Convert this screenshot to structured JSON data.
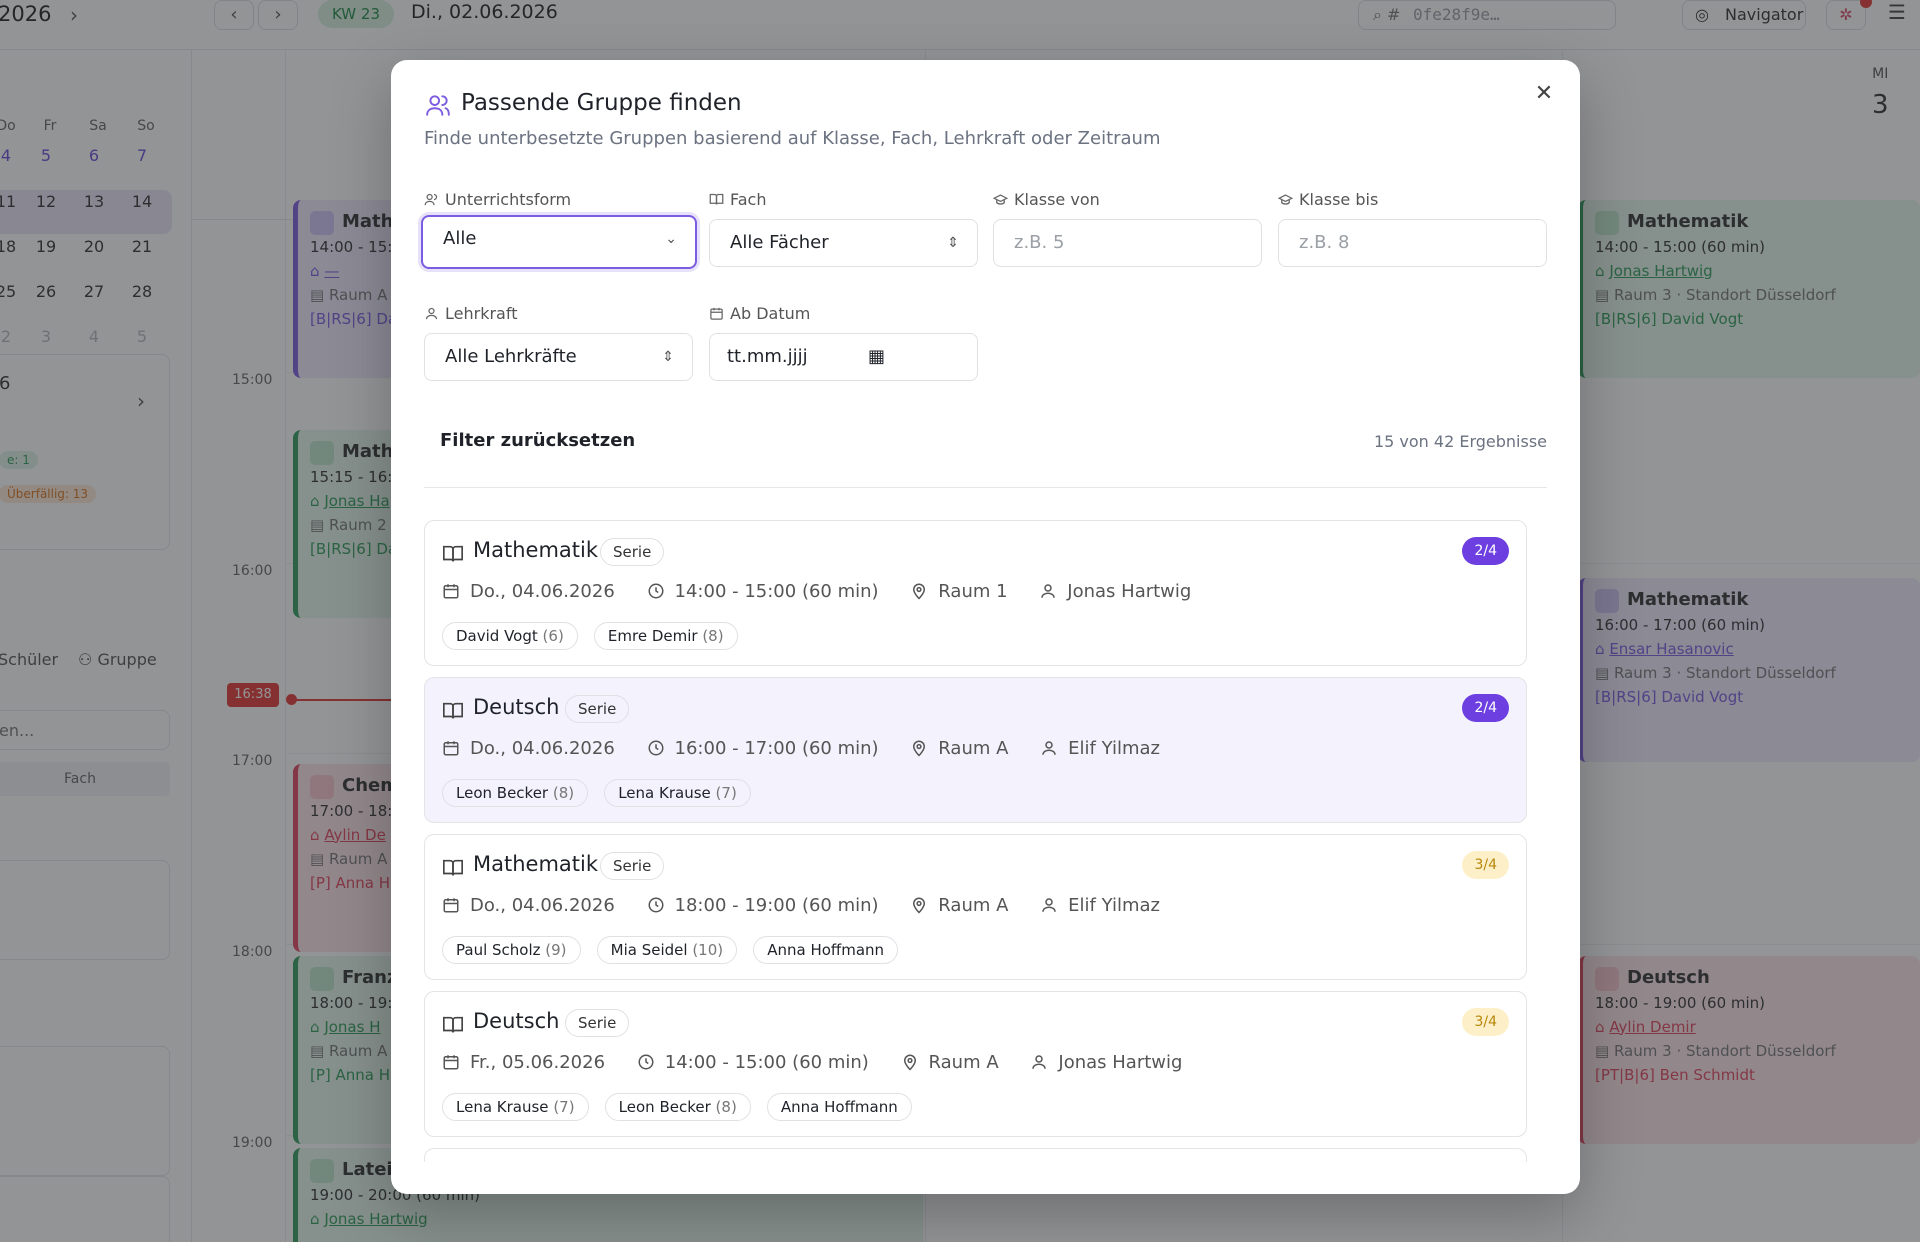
{
  "background": {
    "topbar": {
      "year": "2026",
      "kw": "KW 23",
      "current_date": "Di., 02.06.2026",
      "search_prefix": "#",
      "search_value": "0fe28f9e…",
      "navigator_label": "Navigator"
    },
    "mini_calendar": {
      "headers": [
        "Do",
        "Fr",
        "Sa",
        "So"
      ],
      "weeks": [
        [
          "4",
          "5",
          "6",
          "7"
        ],
        [
          "11",
          "12",
          "13",
          "14"
        ],
        [
          "18",
          "19",
          "20",
          "21"
        ],
        [
          "25",
          "26",
          "27",
          "28"
        ],
        [
          "2",
          "3",
          "4",
          "5"
        ]
      ]
    },
    "sidebar": {
      "num": "6",
      "tag_green": "e: 1",
      "tag_orange": "Überfällig: 13",
      "tab_schueler": "Schüler",
      "tab_gruppe": "Gruppe",
      "search_placeholder": "en...",
      "fach_label": "Fach"
    },
    "times": [
      "15:00",
      "16:00",
      "17:00",
      "18:00",
      "19:00"
    ],
    "now_time": "16:38",
    "day_header": {
      "name": "MI",
      "num": "3"
    },
    "events_left": [
      {
        "title": "Math",
        "time": "14:00 - 15:",
        "teacher": "—",
        "room": "Raum A",
        "group": "[B|RS|6] Da"
      },
      {
        "title": "Mathe",
        "time": "15:15 - 16:",
        "teacher": "Jonas Ha",
        "room": "Raum 2",
        "group": "[B|RS|6] Da"
      },
      {
        "title": "Chem",
        "time": "17:00 - 18:",
        "teacher": "Aylin De",
        "room": "Raum A",
        "group": "[P] Anna H"
      },
      {
        "title": "Franz",
        "time": "18:00 - 19:",
        "teacher": "Jonas H",
        "room": "Raum A",
        "group": "[P] Anna H"
      },
      {
        "title": "Latei",
        "time": "19:00 - 20:00 (60 min)",
        "teacher": "Jonas Hartwig",
        "room": "",
        "group": ""
      }
    ],
    "events_right": [
      {
        "title": "Mathematik",
        "time": "14:00 - 15:00 (60 min)",
        "teacher": "Jonas Hartwig",
        "room": "Raum 3 · Standort Düsseldorf",
        "group": "[B|RS|6] David Vogt"
      },
      {
        "title": "Mathematik",
        "time": "16:00 - 17:00 (60 min)",
        "teacher": "Ensar Hasanovic",
        "room": "Raum 3 · Standort Düsseldorf",
        "group": "[B|RS|6] David Vogt"
      },
      {
        "title": "Deutsch",
        "time": "18:00 - 19:00 (60 min)",
        "teacher": "Aylin Demir",
        "room": "Raum 3 · Standort Düsseldorf",
        "group": "[PT|B|6] Ben Schmidt"
      }
    ]
  },
  "modal": {
    "title": "Passende Gruppe finden",
    "subtitle": "Finde unterbesetzte Gruppen basierend auf Klasse, Fach, Lehrkraft oder Zeitraum",
    "filters": {
      "unterrichtsform": {
        "label": "Unterrichtsform",
        "value": "Alle"
      },
      "fach": {
        "label": "Fach",
        "value": "Alle Fächer"
      },
      "klasse_von": {
        "label": "Klasse von",
        "placeholder": "z.B. 5"
      },
      "klasse_bis": {
        "label": "Klasse bis",
        "placeholder": "z.B. 8"
      },
      "lehrkraft": {
        "label": "Lehrkraft",
        "value": "Alle Lehrkräfte"
      },
      "ab_datum": {
        "label": "Ab Datum",
        "placeholder": "tt.mm.jjjj"
      }
    },
    "reset_label": "Filter zurücksetzen",
    "result_count": "15 von 42 Ergebnisse",
    "results": [
      {
        "subject": "Mathematik",
        "tag": "Serie",
        "capacity": "2/4",
        "capacity_color": "purple",
        "date": "Do., 04.06.2026",
        "time": "14:00 - 15:00 (60 min)",
        "room": "Raum 1",
        "teacher": "Jonas Hartwig",
        "students": [
          {
            "name": "David Vogt",
            "grade": "(6)"
          },
          {
            "name": "Emre Demir",
            "grade": "(8)"
          }
        ]
      },
      {
        "subject": "Deutsch",
        "tag": "Serie",
        "capacity": "2/4",
        "capacity_color": "purple",
        "date": "Do., 04.06.2026",
        "time": "16:00 - 17:00 (60 min)",
        "room": "Raum A",
        "teacher": "Elif Yilmaz",
        "students": [
          {
            "name": "Leon Becker",
            "grade": "(8)"
          },
          {
            "name": "Lena Krause",
            "grade": "(7)"
          }
        ]
      },
      {
        "subject": "Mathematik",
        "tag": "Serie",
        "capacity": "3/4",
        "capacity_color": "yellow",
        "date": "Do., 04.06.2026",
        "time": "18:00 - 19:00 (60 min)",
        "room": "Raum A",
        "teacher": "Elif Yilmaz",
        "students": [
          {
            "name": "Paul Scholz",
            "grade": "(9)"
          },
          {
            "name": "Mia Seidel",
            "grade": "(10)"
          },
          {
            "name": "Anna Hoffmann",
            "grade": ""
          }
        ]
      },
      {
        "subject": "Deutsch",
        "tag": "Serie",
        "capacity": "3/4",
        "capacity_color": "yellow",
        "date": "Fr., 05.06.2026",
        "time": "14:00 - 15:00 (60 min)",
        "room": "Raum A",
        "teacher": "Jonas Hartwig",
        "students": [
          {
            "name": "Lena Krause",
            "grade": "(7)"
          },
          {
            "name": "Leon Becker",
            "grade": "(8)"
          },
          {
            "name": "Anna Hoffmann",
            "grade": ""
          }
        ]
      }
    ]
  }
}
